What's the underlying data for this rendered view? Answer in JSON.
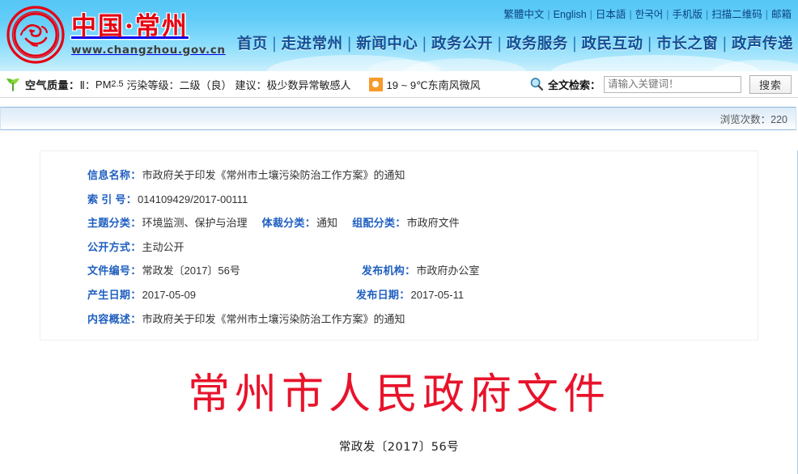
{
  "header": {
    "logo": {
      "emblem_icon": "changzhou-dragon-seal-icon",
      "title_cn": "中国·常州",
      "url": "www.changzhou.gov.cn"
    },
    "top_links": [
      "繁體中文",
      "English",
      "日本語",
      "한국어",
      "手机版",
      "扫描二维码",
      "邮箱"
    ],
    "nav_items": [
      "首页",
      "走进常州",
      "新闻中心",
      "政务公开",
      "政务服务",
      "政民互动",
      "市长之窗",
      "政声传递"
    ],
    "colors": {
      "sky_top": "#55c6f6",
      "sky_bottom": "#cdf0fd",
      "logo_red": "#e60012",
      "nav_blue": "#124f94"
    }
  },
  "infobar": {
    "air_quality": {
      "icon": "green-leaf-icon",
      "label": "空气质量：",
      "station": "Ⅱ：",
      "pollutant": "PM",
      "pollutant_sub": "2.5",
      "level_label": "污染等级：",
      "level_value": "二级（良）",
      "advice_label": "建议：",
      "advice_value": "极少数异常敏感人"
    },
    "weather": {
      "icon": "sun-icon",
      "text": "19 ~ 9℃东南风微风"
    },
    "search": {
      "icon": "search-magnifier-icon",
      "label": "全文检索：",
      "placeholder": "请输入关键词！",
      "value": "",
      "button_label": "搜索"
    }
  },
  "viewbar": {
    "label": "浏览次数：220"
  },
  "info_box": {
    "rows": [
      {
        "label": "信息名称：",
        "value": "市政府关于印发《常州市土壤污染防治工作方案》的通知"
      },
      {
        "label": "索 引 号：",
        "value": "014109429/2017-00111"
      },
      {
        "label": "主题分类：",
        "value": "环境监测、保护与治理",
        "label2": "体裁分类：",
        "value2": "通知",
        "label3": "组配分类：",
        "value3": "市政府文件"
      },
      {
        "label": "公开方式：",
        "value": "主动公开"
      },
      {
        "label": "文件编号：",
        "value": "常政发〔2017〕56号",
        "label2": "发布机构：",
        "value2": "市政府办公室"
      },
      {
        "label": "产生日期：",
        "value": "2017-05-09",
        "label2": "发布日期：",
        "value2": "2017-05-11"
      },
      {
        "label": "内容概述：",
        "value": "市政府关于印发《常州市土壤污染防治工作方案》的通知"
      }
    ]
  },
  "document": {
    "title": "常州市人民政府文件",
    "number": "常政发〔2017〕56号",
    "title_color": "#e8132b"
  }
}
